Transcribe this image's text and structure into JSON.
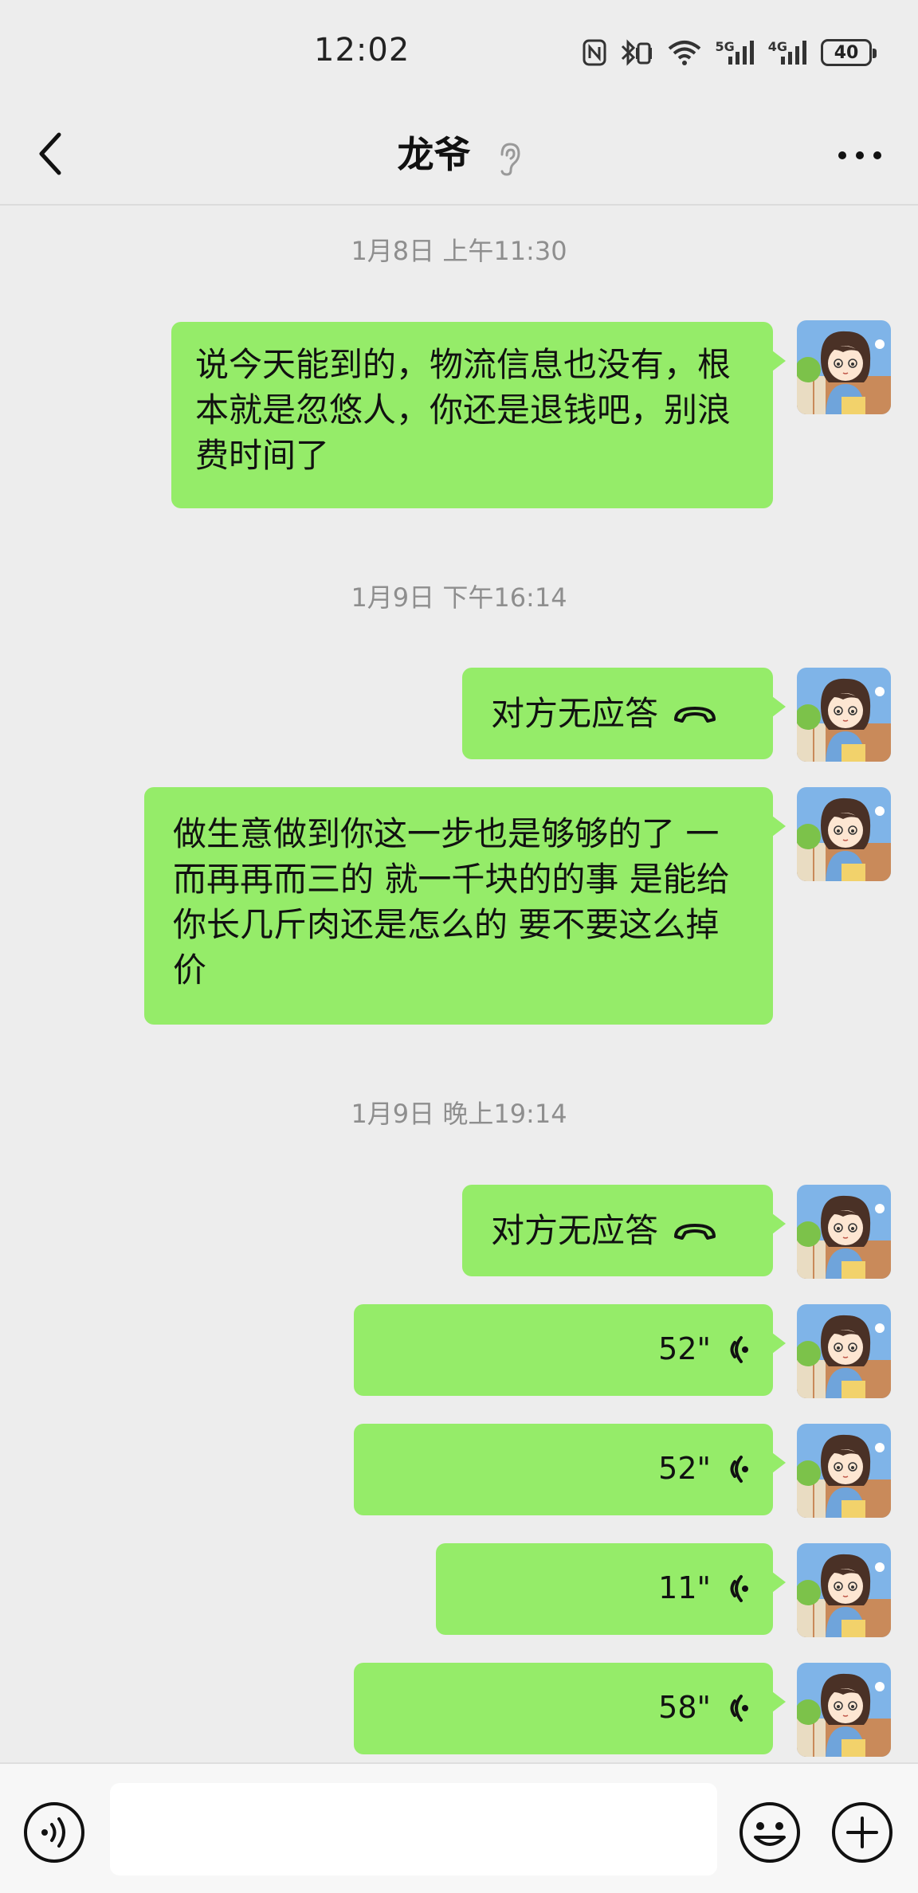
{
  "status_bar": {
    "time": "12:02",
    "signal_labels": [
      "5G",
      "4G"
    ],
    "battery": "40",
    "icons": [
      "nfc-icon",
      "bluetooth-vibrate-icon",
      "wifi-icon",
      "signal-5g-icon",
      "signal-4g-icon",
      "battery-icon"
    ]
  },
  "header": {
    "title": "龙爷",
    "icons": [
      "back-arrow-icon",
      "earpiece-icon",
      "more-icon"
    ]
  },
  "timestamps": [
    "1月8日 上午11:30",
    "1月9日 下午16:14",
    "1月9日 晚上19:14"
  ],
  "messages": [
    {
      "type": "text",
      "text": "说今天能到的，物流信息也没有，根本就是忽悠人，你还是退钱吧，别浪费时间了"
    },
    {
      "type": "call",
      "text": "对方无应答"
    },
    {
      "type": "text",
      "text": "做生意做到你这一步也是够够的了  一而再再而三的  就一千块的的事   是能给你长几斤肉还是怎么的   要不要这么掉价"
    },
    {
      "type": "call",
      "text": "对方无应答"
    },
    {
      "type": "voice",
      "duration": "52\""
    },
    {
      "type": "voice",
      "duration": "52\""
    },
    {
      "type": "voice",
      "duration": "11\""
    },
    {
      "type": "voice",
      "duration": "58\""
    }
  ],
  "input_bar": {
    "placeholder": "",
    "icons": [
      "voice-input-icon",
      "emoji-icon",
      "plus-icon"
    ]
  },
  "colors": {
    "background": "#ededed",
    "bubble": "#95ec69",
    "timestamp": "#8e8e8e"
  }
}
